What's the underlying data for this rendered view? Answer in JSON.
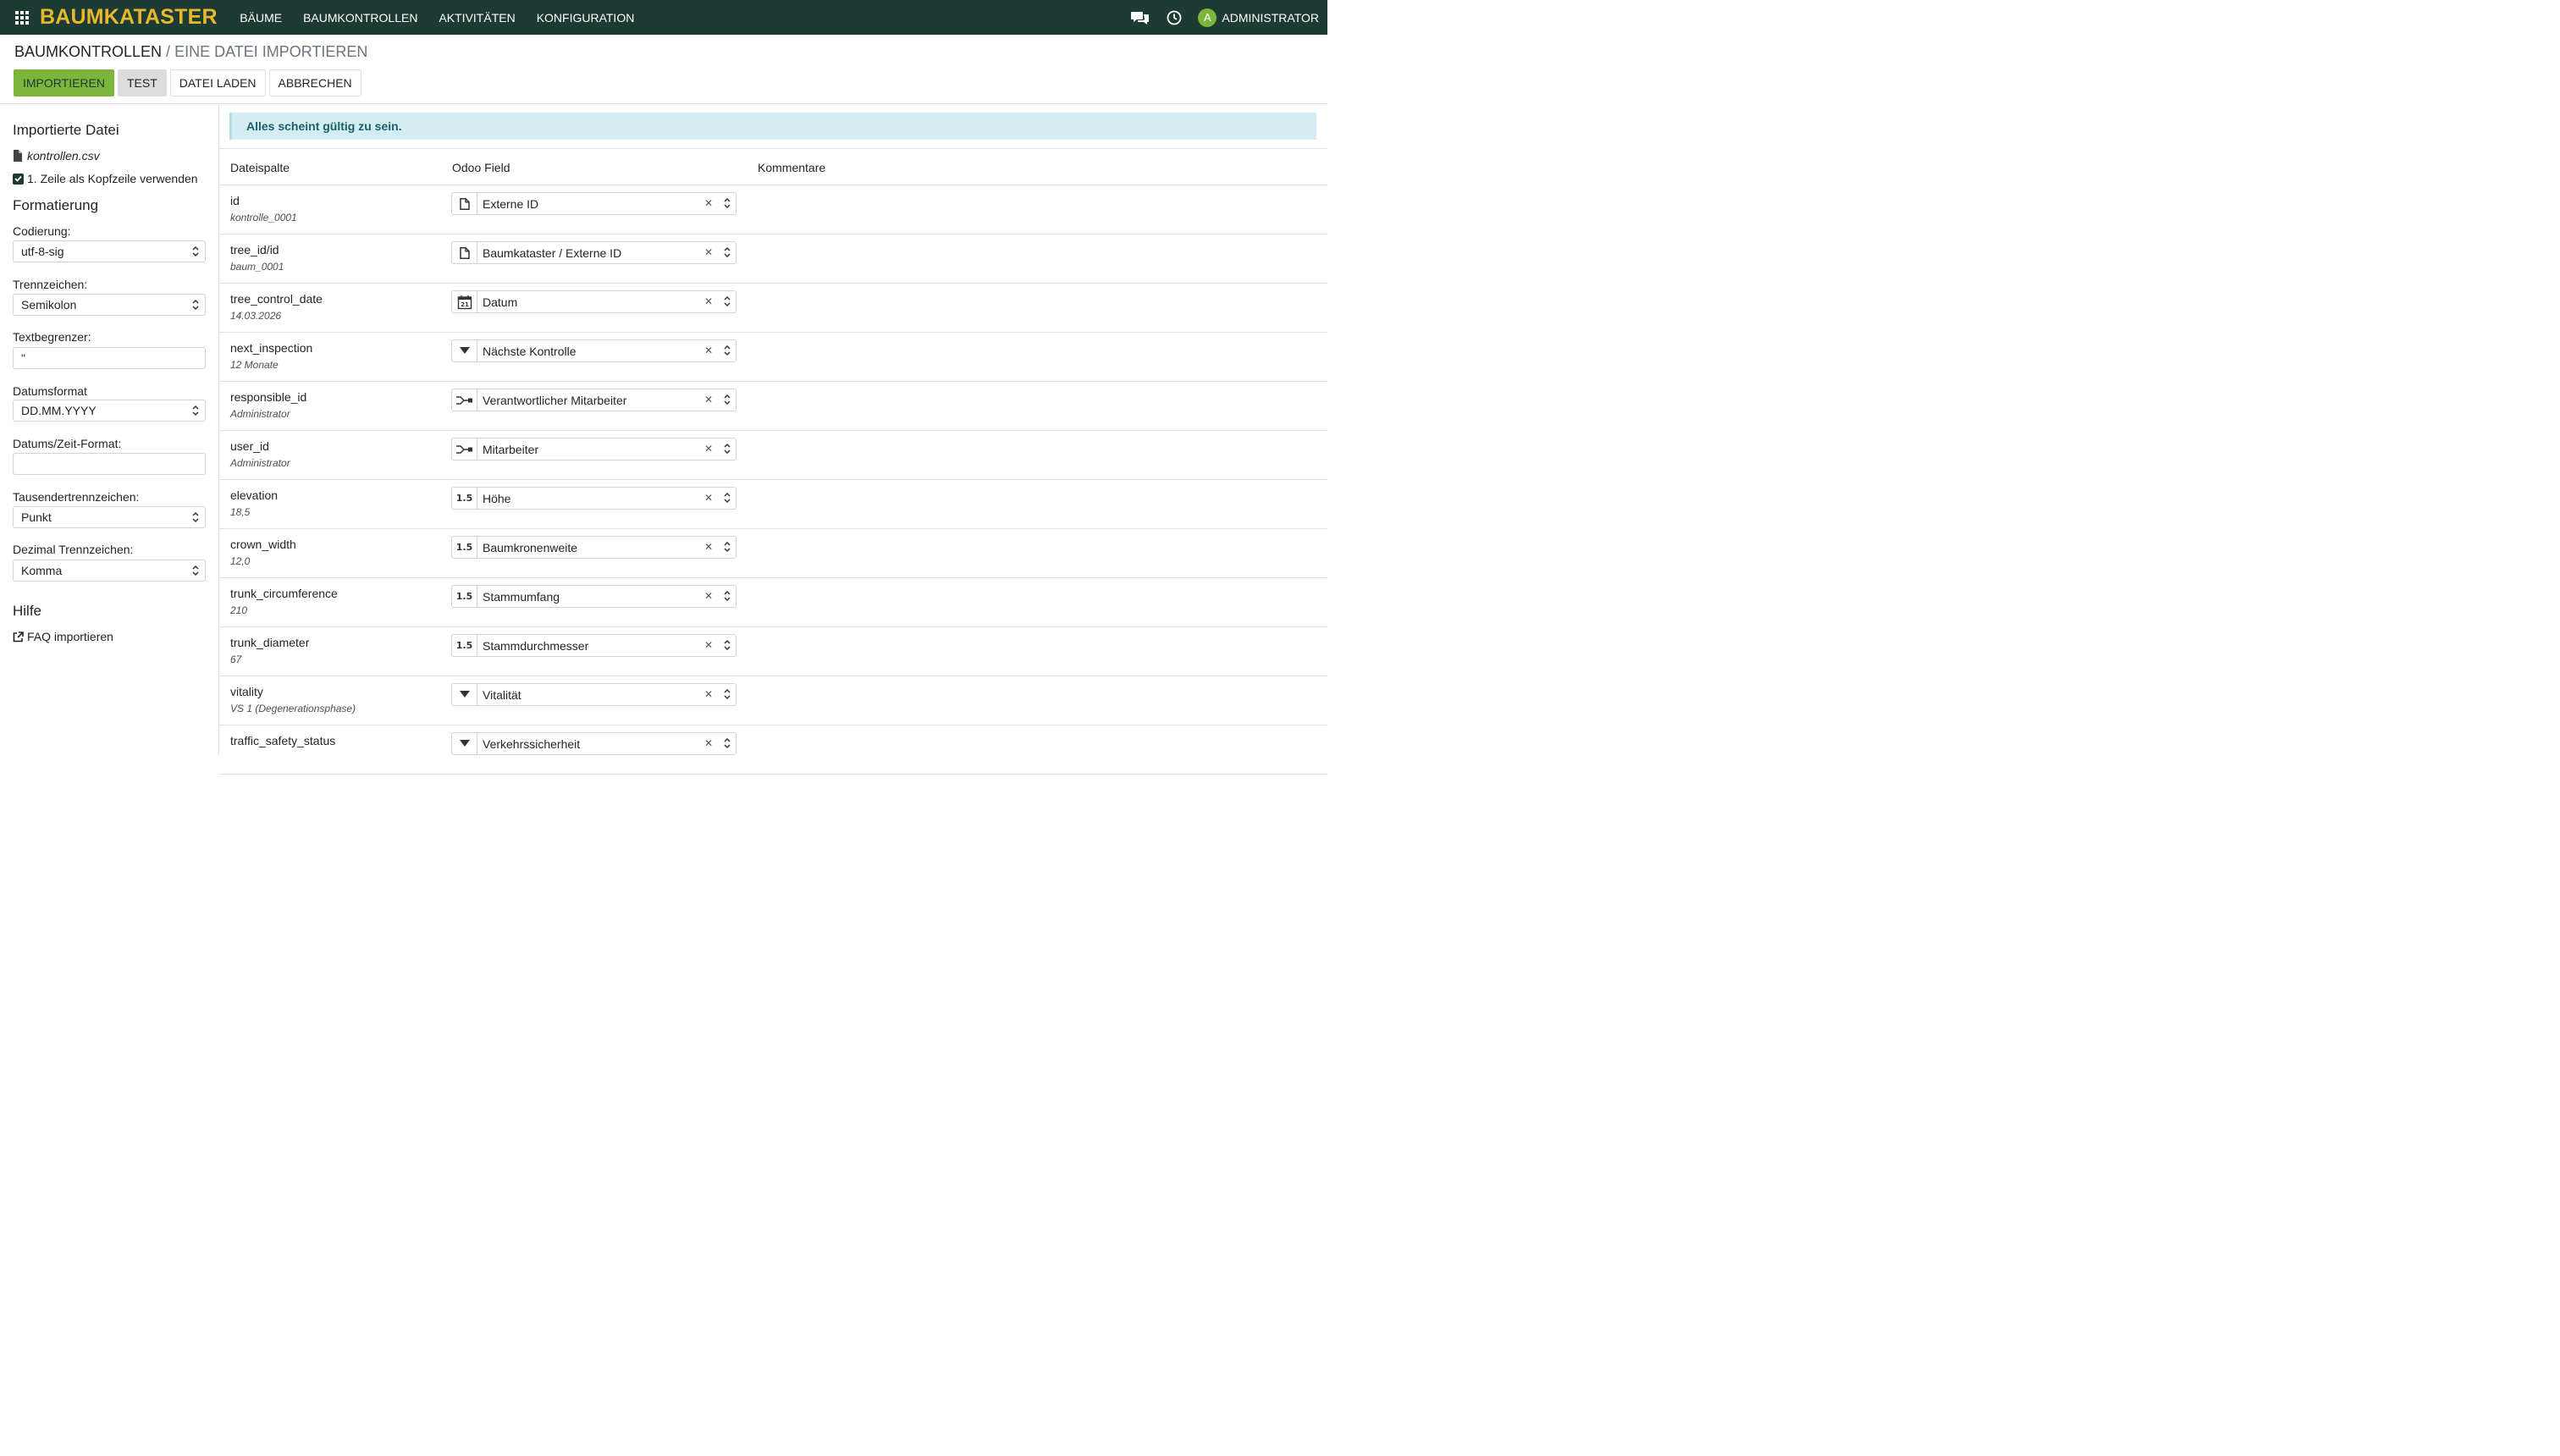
{
  "navbar": {
    "brand": "BAUMKATASTER",
    "menu": [
      "BÄUME",
      "BAUMKONTROLLEN",
      "AKTIVITÄTEN",
      "KONFIGURATION"
    ],
    "avatar_letter": "A",
    "user": "ADMINISTRATOR"
  },
  "breadcrumb": {
    "parent": "BAUMKONTROLLEN",
    "separator": "/",
    "current": "EINE DATEI IMPORTIEREN"
  },
  "buttons": {
    "import": "IMPORTIEREN",
    "test": "TEST",
    "load": "DATEI LADEN",
    "cancel": "ABBRECHEN"
  },
  "sidebar": {
    "imported_heading": "Importierte Datei",
    "filename": "kontrollen.csv",
    "header_checkbox": "1. Zeile als Kopfzeile verwenden",
    "formatting_heading": "Formatierung",
    "encoding_label": "Codierung:",
    "encoding_value": "utf-8-sig",
    "separator_label": "Trennzeichen:",
    "separator_value": "Semikolon",
    "quote_label": "Textbegrenzer:",
    "quote_value": "\"",
    "date_label": "Datumsformat",
    "date_value": "DD.MM.YYYY",
    "datetime_label": "Datums/Zeit-Format:",
    "datetime_value": "",
    "thousands_label": "Tausendertrennzeichen:",
    "thousands_value": "Punkt",
    "decimal_label": "Dezimal Trennzeichen:",
    "decimal_value": "Komma",
    "help_heading": "Hilfe",
    "faq": "FAQ importieren"
  },
  "alert": "Alles scheint gültig zu sein.",
  "table": {
    "headers": {
      "column": "Dateispalte",
      "field": "Odoo Field",
      "comment": "Kommentare"
    },
    "rows": [
      {
        "name": "id",
        "sample": "kontrolle_0001",
        "icon": "file-icon",
        "field": "Externe ID"
      },
      {
        "name": "tree_id/id",
        "sample": "baum_0001",
        "icon": "file-icon",
        "field": "Baumkataster / Externe ID"
      },
      {
        "name": "tree_control_date",
        "sample": "14.03.2026",
        "icon": "calendar-icon",
        "field": "Datum"
      },
      {
        "name": "next_inspection",
        "sample": "12 Monate",
        "icon": "dropdown-icon",
        "field": "Nächste Kontrolle"
      },
      {
        "name": "responsible_id",
        "sample": "Administrator",
        "icon": "relation-icon",
        "field": "Verantwortlicher Mitarbeiter"
      },
      {
        "name": "user_id",
        "sample": "Administrator",
        "icon": "relation-icon",
        "field": "Mitarbeiter"
      },
      {
        "name": "elevation",
        "sample": "18,5",
        "icon": "float-icon",
        "field": "Höhe"
      },
      {
        "name": "crown_width",
        "sample": "12,0",
        "icon": "float-icon",
        "field": "Baumkronenweite"
      },
      {
        "name": "trunk_circumference",
        "sample": "210",
        "icon": "float-icon",
        "field": "Stammumfang"
      },
      {
        "name": "trunk_diameter",
        "sample": "67",
        "icon": "float-icon",
        "field": "Stammdurchmesser"
      },
      {
        "name": "vitality",
        "sample": "VS 1 (Degenerationsphase)",
        "icon": "dropdown-icon",
        "field": "Vitalität"
      },
      {
        "name": "traffic_safety_status",
        "sample": "",
        "icon": "dropdown-icon",
        "field": "Verkehrssicherheit"
      }
    ]
  },
  "icon_glyphs": {
    "float-icon": "1.5",
    "calendar-day": "21"
  },
  "colors": {
    "navbar": "#1d3a33",
    "brand": "#e7b82d",
    "primary": "#7cb53c",
    "alert_bg": "#d3edf2"
  }
}
